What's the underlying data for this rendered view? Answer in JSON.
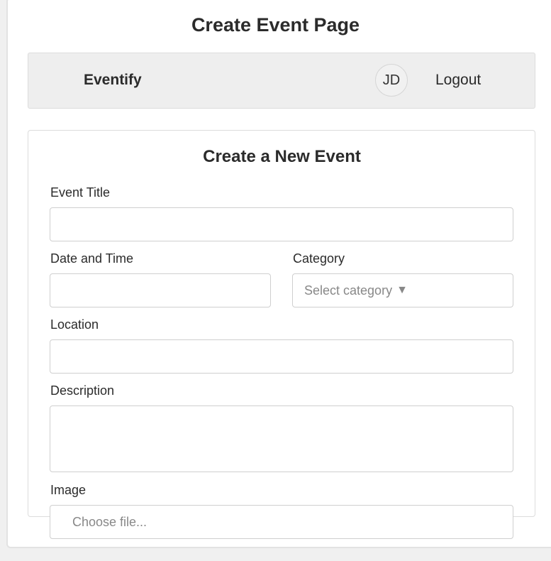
{
  "page": {
    "title": "Create Event Page"
  },
  "navbar": {
    "brand": "Eventify",
    "avatar_initials": "JD",
    "logout_label": "Logout"
  },
  "form": {
    "title": "Create a New Event",
    "event_title": {
      "label": "Event Title",
      "value": ""
    },
    "date_time": {
      "label": "Date and Time",
      "value": ""
    },
    "category": {
      "label": "Category",
      "placeholder": "Select category",
      "arrow": "▼",
      "arrow_icon": "triangle-down-icon"
    },
    "location": {
      "label": "Location",
      "value": ""
    },
    "description": {
      "label": "Description",
      "value": ""
    },
    "image": {
      "label": "Image",
      "placeholder": "Choose file..."
    }
  },
  "colors": {
    "page_background": "#ffffff",
    "navbar_background": "#eeeeee",
    "border": "#cfcfcf",
    "placeholder_text": "#888888"
  }
}
